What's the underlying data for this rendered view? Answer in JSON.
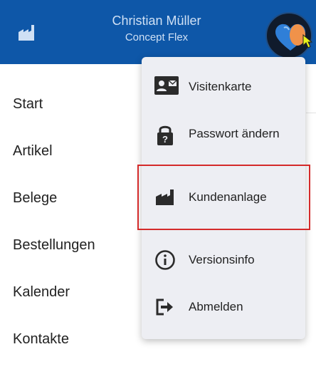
{
  "header": {
    "user_name": "Christian Müller",
    "company": "Concept Flex",
    "background_color": "#0e57a8",
    "icon": "factory-icon"
  },
  "sidebar": {
    "items": [
      {
        "label": "Start"
      },
      {
        "label": "Artikel"
      },
      {
        "label": "Belege"
      },
      {
        "label": "Bestellungen"
      },
      {
        "label": "Kalender"
      },
      {
        "label": "Kontakte"
      }
    ]
  },
  "menu": {
    "items": [
      {
        "label": "Visitenkarte",
        "icon": "contact-card-icon"
      },
      {
        "label": "Passwort ändern",
        "icon": "lock-icon"
      },
      {
        "label": "Kundenanlage",
        "icon": "factory-icon"
      },
      {
        "label": "Versionsinfo",
        "icon": "info-icon"
      },
      {
        "label": "Abmelden",
        "icon": "logout-icon"
      }
    ]
  },
  "highlight_color": "#d42a2a"
}
